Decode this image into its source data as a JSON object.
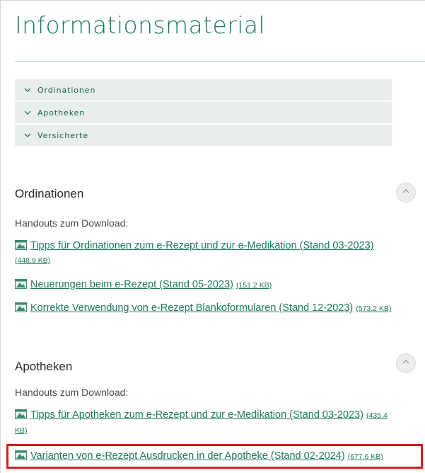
{
  "page_title": "Informationsmaterial",
  "accordion": [
    {
      "label": "Ordinationen"
    },
    {
      "label": "Apotheken"
    },
    {
      "label": "Versicherte"
    }
  ],
  "sections": {
    "ordinationen": {
      "title": "Ordinationen",
      "intro": "Handouts zum Download:",
      "items": [
        {
          "text": "Tipps für Ordinationen zum e-Rezept und zur e-Medikation (Stand 03-2023)",
          "size": "(448.9 KB)"
        },
        {
          "text": "Neuerungen beim e-Rezept (Stand 05-2023)",
          "size": "(151.2 KB)"
        },
        {
          "text": "Korrekte Verwendung von e-Rezept Blankoformularen (Stand 12-2023)",
          "size": "(573.2 KB)"
        }
      ]
    },
    "apotheken": {
      "title": "Apotheken",
      "intro": "Handouts zum Download:",
      "items": [
        {
          "text": "Tipps für Apotheken zum e-Rezept und zur e-Medikation (Stand 03-2023)",
          "size": "(435.4 KB)"
        },
        {
          "text": "Varianten von e-Rezept Ausdrucken in der Apotheke (Stand 02-2024)",
          "size": "(677.6 KB)"
        }
      ]
    }
  },
  "colors": {
    "accent": "#1d7a5a",
    "accordion_bg": "#e7eeec",
    "highlight": "#e0191b"
  },
  "icons": {
    "accordion": "chevron-down-icon",
    "collapse": "chevron-up-icon",
    "file": "pdf-file-icon"
  }
}
